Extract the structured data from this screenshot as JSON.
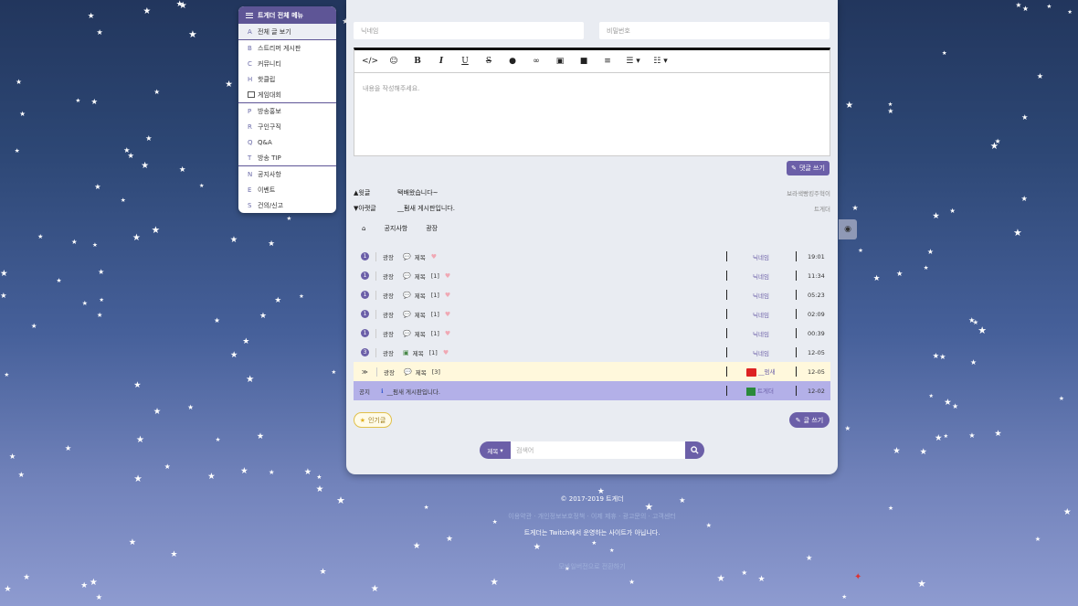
{
  "side_menu": {
    "title": "트게더 전체 메뉴",
    "groups": [
      [
        {
          "key": "A",
          "label": "전체 글 보기"
        }
      ],
      [
        {
          "key": "B",
          "label": "스트리머 게시판"
        },
        {
          "key": "C",
          "label": "커뮤니티"
        },
        {
          "key": "H",
          "label": "핫클립"
        },
        {
          "key": "",
          "label": "게임대회"
        }
      ],
      [
        {
          "key": "P",
          "label": "방송홍보"
        },
        {
          "key": "R",
          "label": "구인구직"
        },
        {
          "key": "Q",
          "label": "Q&A"
        },
        {
          "key": "T",
          "label": "방송 TIP"
        }
      ],
      [
        {
          "key": "N",
          "label": "공지사항"
        },
        {
          "key": "E",
          "label": "이벤트"
        },
        {
          "key": "S",
          "label": "건의/신고"
        }
      ]
    ]
  },
  "form": {
    "nickname_placeholder": "닉네임",
    "password_placeholder": "비밀번호",
    "content_placeholder": "내용을 작성해주세요.",
    "submit_comment": "댓글 쓰기"
  },
  "post_nav": {
    "prev": {
      "label": "▲윗글",
      "title": "택배왔습니다~",
      "author": "보라색빵킹주혁이"
    },
    "next": {
      "label": "▼아랫글",
      "title": "__펌새 게시판입니다.",
      "author": "트게더"
    }
  },
  "tabs": [
    "공지사항",
    "광장"
  ],
  "rows": [
    {
      "num": "1",
      "cat": "광장",
      "title": "제목",
      "count": "",
      "author": "닉네임",
      "time": "19:01",
      "type": "normal",
      "icon": "comment"
    },
    {
      "num": "1",
      "cat": "광장",
      "title": "제목",
      "count": "[1]",
      "author": "닉네임",
      "time": "11:34",
      "type": "normal",
      "icon": "comment"
    },
    {
      "num": "1",
      "cat": "광장",
      "title": "제목",
      "count": "[1]",
      "author": "닉네임",
      "time": "05:23",
      "type": "normal",
      "icon": "comment"
    },
    {
      "num": "1",
      "cat": "광장",
      "title": "제목",
      "count": "[1]",
      "author": "닉네임",
      "time": "02:09",
      "type": "normal",
      "icon": "comment"
    },
    {
      "num": "1",
      "cat": "광장",
      "title": "제목",
      "count": "[1]",
      "author": "닉네임",
      "time": "00:39",
      "type": "normal",
      "icon": "comment"
    },
    {
      "num": "3",
      "cat": "광장",
      "title": "제목",
      "count": "[1]",
      "author": "닉네임",
      "time": "12-05",
      "type": "normal",
      "icon": "image"
    },
    {
      "num": "≫",
      "cat": "광장",
      "title": "제목",
      "count": "[3]",
      "author": "__펌새",
      "time": "12-05",
      "type": "best",
      "icon": "comment"
    },
    {
      "num": "",
      "cat": "공지",
      "title": "__펌새 게시판입니다.",
      "count": "",
      "author": "트게더",
      "time": "12-02",
      "type": "notice",
      "icon": "info"
    }
  ],
  "buttons": {
    "best": "인기글",
    "write": "글 쓰기"
  },
  "search": {
    "select": "제목",
    "placeholder": "검색어"
  },
  "footer": {
    "copyright": "© 2017-2019 트게더",
    "links": "이용약관 · 개인정보보호정책 · 이제 제휴 · 광고문의 · 고객센터",
    "disclaimer": "트게더는 Twitch에서 운영하는 사이트가 아닙니다.",
    "mobile": "모바일버전으로 전환하기"
  }
}
